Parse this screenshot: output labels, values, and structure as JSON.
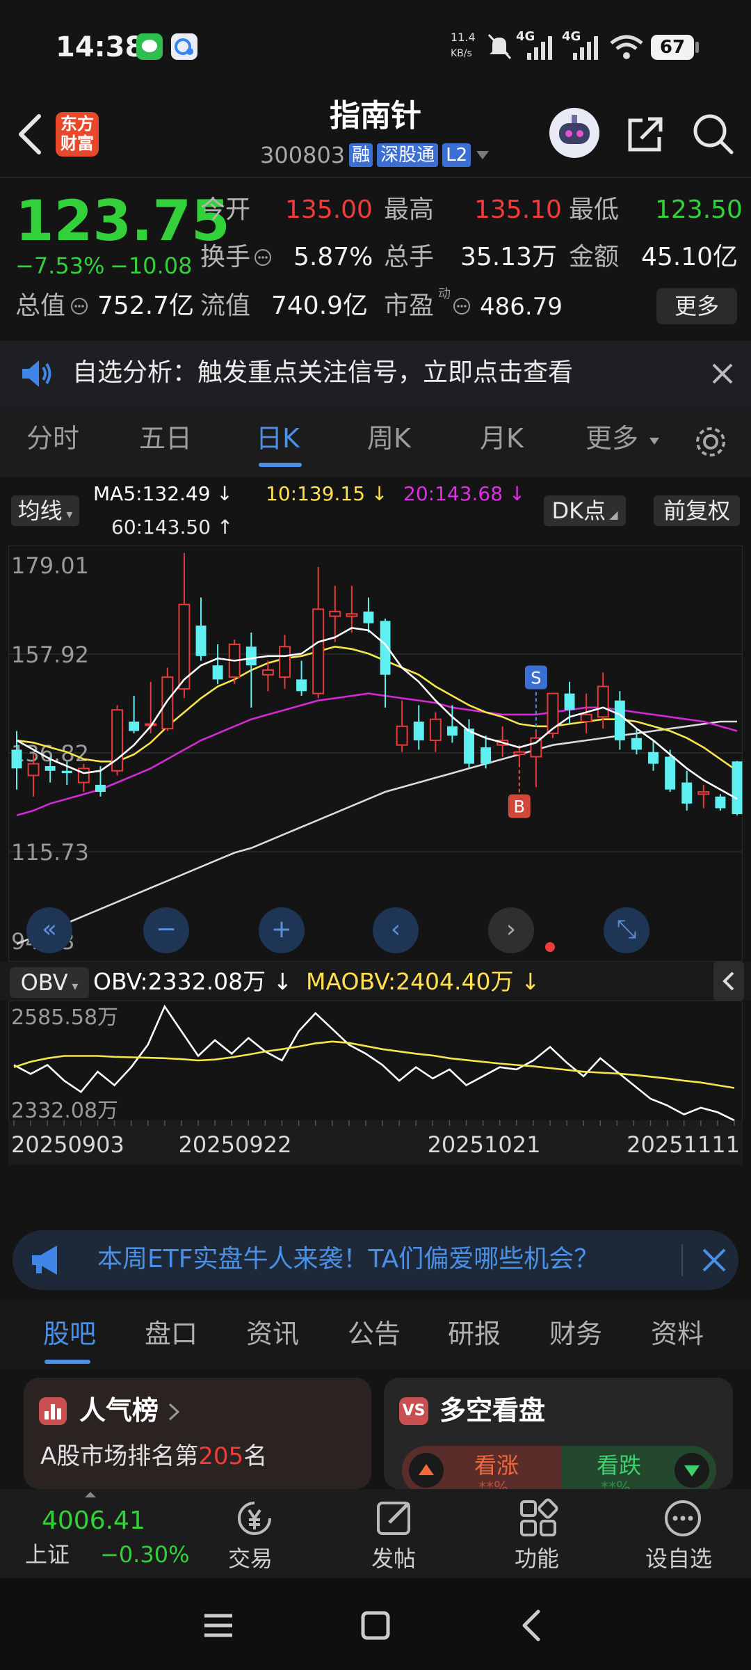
{
  "status_bar": {
    "time": "14:38",
    "net_speed": "11.4",
    "net_unit": "KB/s",
    "signal1": "4G",
    "signal2": "4G",
    "battery": "67"
  },
  "header": {
    "logo_line1": "东方",
    "logo_line2": "财富",
    "stock_name": "指南针",
    "stock_code": "300803",
    "badge_rong": "融",
    "badge_sgt": "深股通",
    "badge_l2": "L2"
  },
  "quote": {
    "price": "123.75",
    "change_pct": "−7.53%",
    "change_amt": "−10.08",
    "open_label": "今开",
    "open_val": "135.00",
    "high_label": "最高",
    "high_val": "135.10",
    "low_label": "最低",
    "low_val": "123.50",
    "turnover_label": "换手",
    "turnover_val": "5.87%",
    "volume_label": "总手",
    "volume_val": "35.13万",
    "amount_label": "金额",
    "amount_val": "45.10亿",
    "mktcap_label": "总值",
    "mktcap_val": "752.7亿",
    "float_label": "流值",
    "float_val": "740.9亿",
    "pe_label": "市盈",
    "pe_sup": "动",
    "pe_val": "486.79",
    "more_btn": "更多"
  },
  "notice": {
    "text": "自选分析：触发重点关注信号，立即点击查看"
  },
  "chart_tabs": [
    "分时",
    "五日",
    "日K",
    "周K",
    "月K",
    "更多"
  ],
  "chart_tab_active": "日K",
  "indicators": {
    "ma_select": "均线",
    "ma5": "MA5:132.49 ↓",
    "ma10": "10:139.15 ↓",
    "ma20": "20:143.68 ↓",
    "ma60": "60:143.50 ↑",
    "dk_btn": "DK点",
    "fq_btn": "前复权",
    "obv_select": "OBV",
    "obv_val": "OBV:2332.08万 ↓",
    "maobv_val": "MAOBV:2404.40万 ↓"
  },
  "colors": {
    "up": "#f23c3c",
    "down": "#32d13a",
    "candle_down": "#5ef0f0",
    "ma5": "#ffffff",
    "ma10": "#f7e64a",
    "ma20": "#d42ad6",
    "ma60": "#dcdcdc",
    "accent": "#4a90e8"
  },
  "chart_data": [
    {
      "type": "candlestick",
      "y_ticks": [
        "179.01",
        "157.92",
        "136.82",
        "115.73",
        "94.63"
      ],
      "ylim": [
        94.63,
        179.01
      ],
      "x_ticks": [
        "20250903",
        "20250922",
        "20251021",
        "20251111"
      ],
      "markers": [
        {
          "label": "S",
          "index": 31
        },
        {
          "label": "B",
          "index": 30
        }
      ],
      "candles": [
        {
          "o": 137.5,
          "h": 141.5,
          "l": 129.0,
          "c": 133.5
        },
        {
          "o": 132.0,
          "h": 136.5,
          "l": 127.5,
          "c": 134.5
        },
        {
          "o": 134.0,
          "h": 136.0,
          "l": 130.5,
          "c": 133.0
        },
        {
          "o": 133.0,
          "h": 135.0,
          "l": 130.0,
          "c": 132.5
        },
        {
          "o": 130.5,
          "h": 134.5,
          "l": 128.5,
          "c": 133.5
        },
        {
          "o": 130.0,
          "h": 134.0,
          "l": 127.5,
          "c": 128.5
        },
        {
          "o": 133.0,
          "h": 147.0,
          "l": 132.0,
          "c": 146.0
        },
        {
          "o": 143.5,
          "h": 149.0,
          "l": 141.0,
          "c": 141.5
        },
        {
          "o": 143.0,
          "h": 152.0,
          "l": 141.0,
          "c": 143.0
        },
        {
          "o": 142.0,
          "h": 155.0,
          "l": 141.5,
          "c": 153.0
        },
        {
          "o": 150.5,
          "h": 179.5,
          "l": 148.5,
          "c": 168.5
        },
        {
          "o": 164.0,
          "h": 170.0,
          "l": 156.5,
          "c": 157.5
        },
        {
          "o": 155.5,
          "h": 160.0,
          "l": 151.5,
          "c": 152.5
        },
        {
          "o": 153.0,
          "h": 161.0,
          "l": 151.5,
          "c": 160.0
        },
        {
          "o": 159.5,
          "h": 162.5,
          "l": 146.5,
          "c": 155.5
        },
        {
          "o": 153.5,
          "h": 156.5,
          "l": 150.0,
          "c": 154.5
        },
        {
          "o": 153.0,
          "h": 162.0,
          "l": 150.5,
          "c": 159.5
        },
        {
          "o": 152.5,
          "h": 156.5,
          "l": 149.0,
          "c": 150.0
        },
        {
          "o": 149.5,
          "h": 176.5,
          "l": 148.5,
          "c": 167.5
        },
        {
          "o": 166.0,
          "h": 172.5,
          "l": 160.5,
          "c": 167.0
        },
        {
          "o": 166.0,
          "h": 172.5,
          "l": 162.5,
          "c": 166.5
        },
        {
          "o": 167.0,
          "h": 170.0,
          "l": 162.5,
          "c": 164.5
        },
        {
          "o": 165.0,
          "h": 165.5,
          "l": 146.5,
          "c": 153.5
        },
        {
          "o": 138.5,
          "h": 148.0,
          "l": 137.0,
          "c": 142.5
        },
        {
          "o": 143.5,
          "h": 147.0,
          "l": 137.5,
          "c": 139.5
        },
        {
          "o": 139.5,
          "h": 145.5,
          "l": 137.0,
          "c": 144.0
        },
        {
          "o": 142.5,
          "h": 147.0,
          "l": 139.0,
          "c": 140.5
        },
        {
          "o": 142.0,
          "h": 144.0,
          "l": 133.5,
          "c": 134.5
        },
        {
          "o": 138.0,
          "h": 140.5,
          "l": 133.5,
          "c": 134.5
        },
        {
          "o": 138.5,
          "h": 142.5,
          "l": 136.0,
          "c": 139.5
        },
        {
          "o": 136.5,
          "h": 138.5,
          "l": 134.5,
          "c": 137.0
        },
        {
          "o": 136.0,
          "h": 141.5,
          "l": 129.5,
          "c": 140.0
        },
        {
          "o": 141.0,
          "h": 148.0,
          "l": 140.0,
          "c": 149.5
        },
        {
          "o": 149.5,
          "h": 152.0,
          "l": 143.0,
          "c": 146.0
        },
        {
          "o": 143.5,
          "h": 149.5,
          "l": 141.0,
          "c": 145.0
        },
        {
          "o": 144.5,
          "h": 154.0,
          "l": 142.0,
          "c": 151.0
        },
        {
          "o": 148.0,
          "h": 150.0,
          "l": 137.5,
          "c": 139.5
        },
        {
          "o": 140.0,
          "h": 142.0,
          "l": 136.5,
          "c": 137.5
        },
        {
          "o": 137.0,
          "h": 139.5,
          "l": 133.0,
          "c": 134.5
        },
        {
          "o": 136.0,
          "h": 137.5,
          "l": 128.5,
          "c": 129.0
        },
        {
          "o": 130.5,
          "h": 133.0,
          "l": 124.5,
          "c": 126.0
        },
        {
          "o": 128.0,
          "h": 130.0,
          "l": 125.0,
          "c": 128.5
        },
        {
          "o": 127.5,
          "h": 128.0,
          "l": 124.5,
          "c": 125.0
        },
        {
          "o": 135.0,
          "h": 135.1,
          "l": 123.5,
          "c": 123.75
        }
      ],
      "ma5": [
        139.5,
        137.5,
        135.5,
        134.0,
        132.5,
        133.0,
        135.5,
        138.5,
        142.5,
        148.0,
        152.5,
        155.5,
        157.0,
        156.5,
        157.0,
        157.5,
        157.5,
        158.0,
        160.5,
        161.5,
        163.5,
        163.0,
        160.0,
        155.0,
        152.0,
        148.0,
        144.5,
        141.5,
        140.0,
        139.0,
        138.0,
        139.0,
        142.0,
        144.5,
        145.5,
        146.5,
        145.0,
        142.0,
        139.5,
        136.5,
        133.5,
        131.0,
        129.0,
        127.0
      ],
      "ma10": [
        139.5,
        139.0,
        138.0,
        137.0,
        135.5,
        135.0,
        135.0,
        136.5,
        139.0,
        142.5,
        145.5,
        148.5,
        151.0,
        152.5,
        154.5,
        156.0,
        157.0,
        157.5,
        158.5,
        159.5,
        159.0,
        158.0,
        156.5,
        155.0,
        153.5,
        151.0,
        149.0,
        147.0,
        145.5,
        144.5,
        143.0,
        142.5,
        142.5,
        143.0,
        143.5,
        144.0,
        144.0,
        143.5,
        142.5,
        141.5,
        140.0,
        138.0,
        135.5,
        133.0
      ],
      "ma20": [
        123.5,
        124.5,
        126.0,
        127.0,
        128.0,
        129.0,
        130.5,
        132.0,
        133.5,
        135.5,
        137.5,
        139.5,
        141.0,
        142.5,
        144.0,
        145.0,
        146.0,
        147.0,
        148.0,
        148.5,
        149.0,
        149.5,
        149.0,
        148.5,
        148.0,
        147.5,
        146.5,
        146.0,
        145.5,
        145.0,
        145.0,
        145.0,
        145.5,
        146.0,
        146.5,
        146.5,
        146.0,
        145.5,
        145.0,
        144.5,
        144.0,
        143.5,
        142.5,
        141.5
      ],
      "ma60": [
        96.0,
        97.5,
        99.0,
        100.5,
        102.0,
        103.5,
        105.0,
        106.5,
        108.0,
        109.5,
        111.0,
        112.5,
        114.0,
        115.5,
        116.5,
        118.0,
        119.5,
        121.0,
        122.5,
        124.0,
        125.5,
        127.0,
        128.5,
        129.5,
        130.5,
        131.5,
        132.5,
        133.5,
        134.5,
        135.5,
        136.5,
        137.5,
        138.5,
        139.0,
        139.5,
        140.0,
        140.5,
        141.0,
        141.5,
        142.0,
        142.5,
        143.0,
        143.5,
        143.5
      ]
    },
    {
      "type": "line",
      "y_ticks": [
        "2585.58万",
        "2332.08万"
      ],
      "ylim": [
        2332.08,
        2585.58
      ],
      "series": [
        {
          "name": "OBV",
          "values": [
            2455,
            2435,
            2455,
            2420,
            2395,
            2440,
            2410,
            2450,
            2500,
            2585,
            2530,
            2475,
            2510,
            2480,
            2515,
            2485,
            2465,
            2530,
            2570,
            2535,
            2500,
            2480,
            2455,
            2420,
            2450,
            2425,
            2445,
            2410,
            2430,
            2450,
            2445,
            2465,
            2495,
            2460,
            2430,
            2470,
            2440,
            2410,
            2380,
            2365,
            2345,
            2360,
            2350,
            2332
          ]
        },
        {
          "name": "MAOBV",
          "values": [
            2450,
            2462,
            2470,
            2475,
            2475,
            2475,
            2473,
            2472,
            2471,
            2470,
            2468,
            2465,
            2467,
            2472,
            2478,
            2485,
            2490,
            2496,
            2503,
            2507,
            2504,
            2497,
            2490,
            2485,
            2480,
            2476,
            2470,
            2466,
            2462,
            2458,
            2455,
            2452,
            2448,
            2444,
            2440,
            2438,
            2436,
            2433,
            2429,
            2425,
            2420,
            2416,
            2410,
            2404
          ]
        }
      ]
    }
  ],
  "chart_controls": [
    "fast-back",
    "zoom-out",
    "zoom-in",
    "prev",
    "next",
    "fullscreen"
  ],
  "banner": {
    "text": "本周ETF实盘牛人来袭！TA们偏爱哪些机会？"
  },
  "bottom_tabs": [
    "股吧",
    "盘口",
    "资讯",
    "公告",
    "研报",
    "财务",
    "资料"
  ],
  "bottom_tab_active": "股吧",
  "cards": {
    "popular_title": "人气榜",
    "popular_prefix": "A股市场排名第",
    "popular_rank": "205",
    "popular_suffix": "名",
    "vs_title": "多空看盘",
    "vs_up": "看涨",
    "vs_down": "看跌",
    "vs_up_pct": "**%",
    "vs_down_pct": "**%"
  },
  "bottom_bar": {
    "index_val": "4006.41",
    "index_name": "上证",
    "index_chg": "−0.30%",
    "trade": "交易",
    "post": "发帖",
    "func": "功能",
    "watch": "设自选"
  }
}
